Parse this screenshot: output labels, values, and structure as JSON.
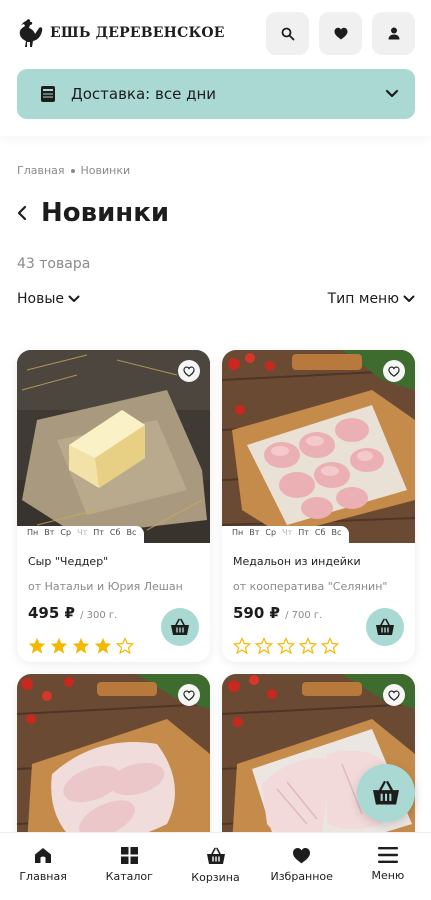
{
  "header": {
    "logo_text": "ЕШЬ ДЕРЕВЕНСКОЕ",
    "icons": [
      "search-icon",
      "heart-icon",
      "user-icon"
    ]
  },
  "delivery": {
    "label": "Доставка: все дни",
    "icon": "calendar-icon"
  },
  "breadcrumb": {
    "items": [
      "Главная",
      "Новинки"
    ]
  },
  "page": {
    "title": "Новинки",
    "count": "43 товара"
  },
  "filters": {
    "sort_label": "Новые",
    "menu_type_label": "Тип меню"
  },
  "days": [
    "Пн",
    "Вт",
    "Ср",
    "Чт",
    "Пт",
    "Сб",
    "Вс"
  ],
  "products": [
    {
      "name": "Сыр \"Чеддер\"",
      "farmer": "от Натальи и Юрия Лешан",
      "price": "495 ₽",
      "unit": "/ 300 г.",
      "rating": 4,
      "available_days": [
        true,
        true,
        true,
        false,
        true,
        true,
        true
      ]
    },
    {
      "name": "Медальон из индейки",
      "farmer": "от кооператива \"Селянин\"",
      "price": "590 ₽",
      "unit": "/ 700 г.",
      "rating": 0,
      "available_days": [
        true,
        true,
        true,
        false,
        true,
        true,
        true
      ]
    },
    {
      "name": "",
      "farmer": "",
      "price": "",
      "unit": "",
      "rating": 0
    },
    {
      "name": "",
      "farmer": "",
      "price": "",
      "unit": "",
      "rating": 0
    }
  ],
  "nav": {
    "items": [
      {
        "label": "Главная",
        "icon": "home-icon"
      },
      {
        "label": "Каталог",
        "icon": "grid-icon"
      },
      {
        "label": "Корзина",
        "icon": "basket-icon"
      },
      {
        "label": "Избранное",
        "icon": "heart-icon"
      },
      {
        "label": "Меню",
        "icon": "menu-icon"
      }
    ]
  },
  "colors": {
    "accent": "#a9d9d2",
    "star": "#f5b800",
    "text": "#1d1d1d",
    "muted": "#8a8a8a"
  }
}
